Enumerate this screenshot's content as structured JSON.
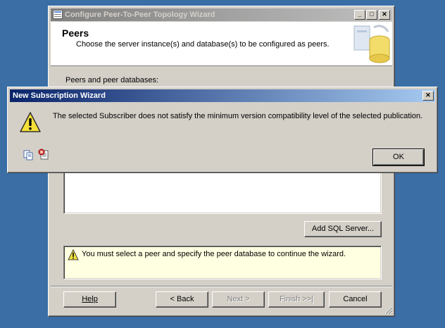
{
  "main_window": {
    "title": "Configure Peer-To-Peer Topology Wizard",
    "header_title": "Peers",
    "header_subtitle": "Choose the server instance(s) and database(s) to be configured as peers.",
    "section_label": "Peers and peer databases:",
    "add_sql_server_label": "Add SQL Server...",
    "warning_text": "You must select a peer and specify the peer database to continue the wizard.",
    "buttons": {
      "help": "Help",
      "back": "< Back",
      "next": "Next >",
      "finish": "Finish >>|",
      "cancel": "Cancel"
    }
  },
  "dialog": {
    "title": "New Subscription Wizard",
    "message": "The selected Subscriber does not satisfy the minimum version compatibility level of the selected publication.",
    "ok_label": "OK"
  },
  "colors": {
    "desktop": "#3a6ea5",
    "face": "#d4d0c8",
    "active_title": "#0a246a",
    "warning_bg": "#ffffe1"
  }
}
